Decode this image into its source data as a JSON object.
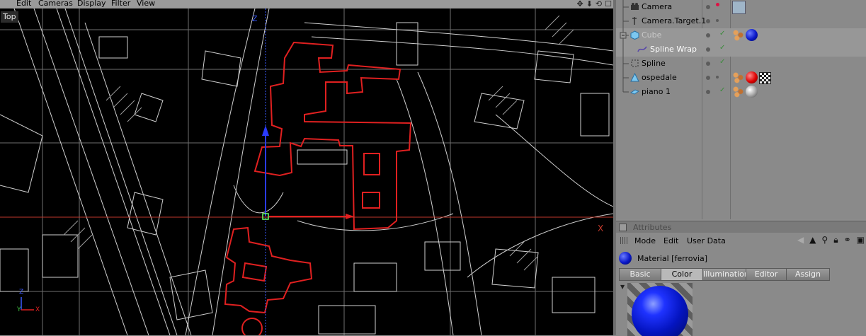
{
  "viewport": {
    "menu": [
      "Edit",
      "Cameras",
      "Display",
      "Filter",
      "View"
    ],
    "view_label": "Top",
    "axis_x": "X",
    "axis_y": "Y",
    "axis_z": "Z"
  },
  "object_manager": {
    "objects": [
      {
        "name": "Camera",
        "icon": "camera-icon",
        "tags": [
          "camera-tag",
          "target-tag"
        ]
      },
      {
        "name": "Camera.Target.1",
        "icon": "null-target-icon",
        "tags": []
      },
      {
        "name": "Cube",
        "icon": "cube-icon",
        "tags": [
          "texture-tag",
          "blue-material"
        ],
        "greyed": true
      },
      {
        "name": "Spline Wrap",
        "icon": "spline-wrap-icon",
        "tags": []
      },
      {
        "name": "Spline",
        "icon": "spline-icon",
        "tags": []
      },
      {
        "name": "ospedale",
        "icon": "polygon-object-icon",
        "tags": [
          "texture-tag",
          "red-material",
          "checker-material"
        ]
      },
      {
        "name": "piano 1",
        "icon": "plane-icon",
        "tags": [
          "texture-tag",
          "grey-material"
        ]
      }
    ]
  },
  "attributes": {
    "title": "Attributes",
    "menu": [
      "Mode",
      "Edit",
      "User Data"
    ],
    "material_name": "Material [ferrovia]",
    "tabs": [
      "Basic",
      "Color",
      "Illumination",
      "Editor",
      "Assign"
    ],
    "active_tab": "Color"
  },
  "colors": {
    "viewport_bg": "#000000",
    "map_lines": "#cfcfcf",
    "selection_red": "#e02020",
    "panel_grey": "#8a8a8a",
    "material_blue": "#0a18c8"
  }
}
